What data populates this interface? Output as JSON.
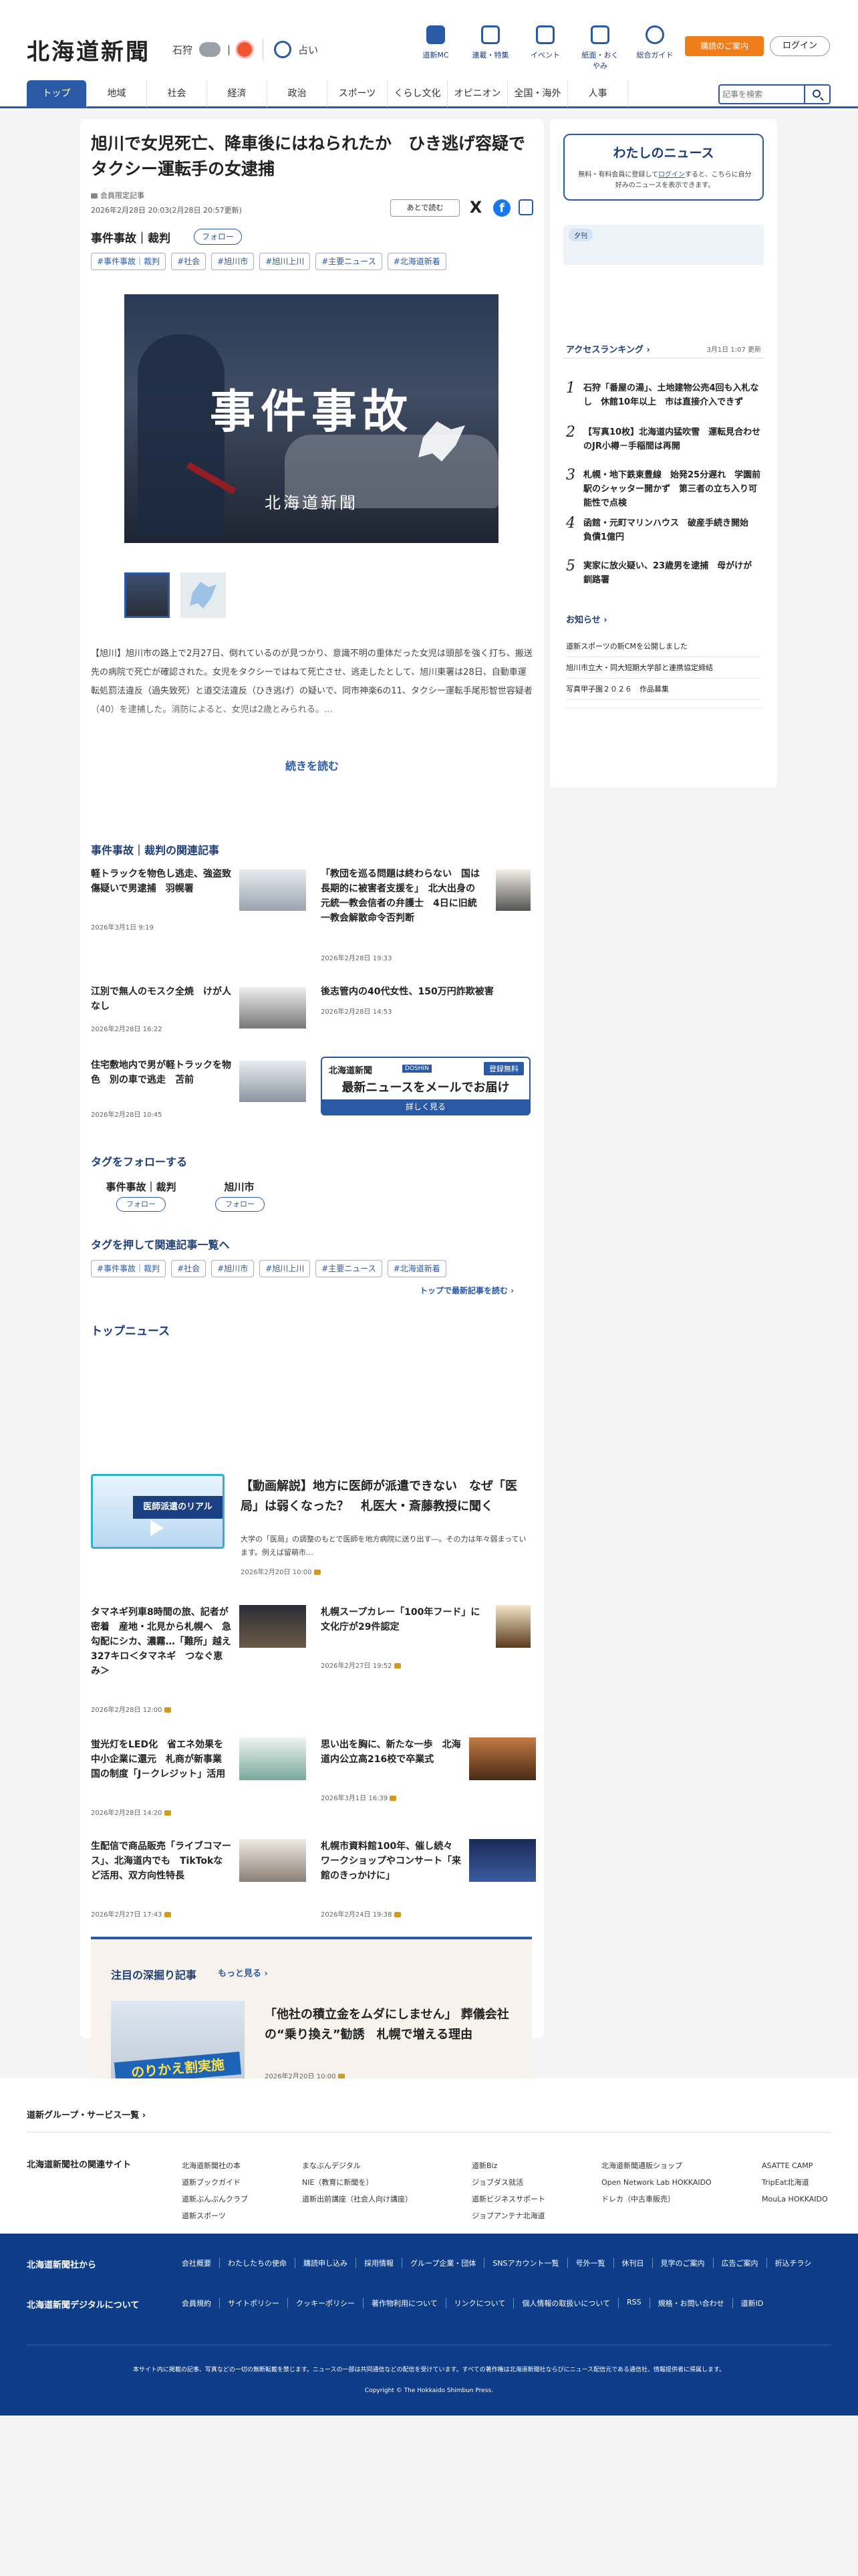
{
  "header": {
    "logo": "北海道新聞",
    "weather": {
      "city": "石狩",
      "fortune": "占い"
    },
    "nav": [
      {
        "label": "道新MC",
        "icon": "book-icon"
      },
      {
        "label": "連載・特集",
        "icon": "flag-icon"
      },
      {
        "label": "イベント",
        "icon": "calendar-icon"
      },
      {
        "label": "紙面・おくやみ",
        "icon": "newspaper-icon"
      },
      {
        "label": "総合ガイド",
        "icon": "help-icon"
      }
    ],
    "subscribe": "購読のご案内",
    "login": "ログイン"
  },
  "gnav": {
    "items": [
      "トップ",
      "地域",
      "社会",
      "経済",
      "政治",
      "スポーツ",
      "くらし文化",
      "オピニオン",
      "全国・海外",
      "人事"
    ],
    "search_placeholder": "記事を検索"
  },
  "article": {
    "title": "旭川で女児死亡、降車後にはねられたか　ひき逃げ容疑でタクシー運転手の女逮捕",
    "members_only": "会員限定記事",
    "date": "2026年2月28日 20:03(2月28日 20:57更新)",
    "read_later": "あとで読む",
    "category": "事件事故｜裁判",
    "follow": "フォロー",
    "tags": [
      "#事件事故｜裁判",
      "#社会",
      "#旭川市",
      "#旭川上川",
      "#主要ニュース",
      "#北海道新着"
    ],
    "hero_text": "事件事故",
    "hero_brand": "北海道新聞",
    "lead": "【旭川】旭川市の路上で2月27日、倒れているのが見つかり、意識不明の重体だった女児は頭部を強く打ち、搬送先の病院で死亡が確認された。女児をタクシーではねて死亡させ、逃走したとして、旭川東署は28日、自動車運転処罰法違反（過失致死）と道交法違反（ひき逃げ）の疑いで、同市神楽6の11、タクシー運転手尾形智世容疑者（40）を逮捕した。消防によると、女児は2歳とみられる。…",
    "read_more": "続きを読む"
  },
  "related": {
    "heading": "事件事故｜裁判の関連記事",
    "items": [
      {
        "title": "軽トラックを物色し逃走、強盗致傷疑いで男逮捕　羽幌署",
        "date": "2026年3月1日 9:19"
      },
      {
        "title": "「教団を巡る問題は終わらない　国は長期的に被害者支援を」　北大出身の元統一教会信者の弁護士　4日に旧統一教会解散命令否判断",
        "date": "2026年2月28日 19:33"
      },
      {
        "title": "江別で無人のモスク全焼　けが人なし",
        "date": "2026年2月28日 16:22"
      },
      {
        "title": "後志管内の40代女性、150万円詐欺被害",
        "date": "2026年2月28日 14:53"
      },
      {
        "title": "住宅敷地内で男が軽トラックを物色　別の車で逃走　苫前",
        "date": "2026年2月28日 10:45"
      }
    ],
    "ad": {
      "brand": "北海道新聞",
      "pill": "DOSHIN",
      "free": "登録無料",
      "headline": "最新ニュースをメールでお届け",
      "cta": "詳しく見る"
    }
  },
  "follow_tags": {
    "heading": "タグをフォローする",
    "items": [
      {
        "label": "事件事故｜裁判",
        "button": "フォロー"
      },
      {
        "label": "旭川市",
        "button": "フォロー"
      }
    ]
  },
  "tag_list": {
    "heading": "タグを押して関連記事一覧へ",
    "items": [
      "#事件事故｜裁判",
      "#社会",
      "#旭川市",
      "#旭川上川",
      "#主要ニュース",
      "#北海道新着"
    ],
    "latest_link": "トップで最新記事を読む"
  },
  "top_news": {
    "heading": "トップニュース",
    "feature": {
      "title": "【動画解説】地方に医師が派遣できない　なぜ「医局」は弱くなった？　札医大・斎藤教授に聞く",
      "summary": "大学の「医局」の調整のもとで医師を地方病院に送り出す―。その力は年々弱まっています。例えば留萌市…",
      "date": "2026年2月20日 10:00",
      "video_caption": "医師派遣のリアル"
    },
    "items": [
      {
        "title": "タマネギ列車8時間の旅、記者が密着　産地・北見から札幌へ　急勾配にシカ、濃霧…「難所」越え327キロ＜タマネギ　つなぐ恵み＞",
        "date": "2026年2月28日 12:00"
      },
      {
        "title": "札幌スープカレー「100年フード」に　文化庁が29件認定",
        "date": "2026年2月27日 19:52"
      },
      {
        "title": "蛍光灯をLED化　省エネ効果を中小企業に還元　札商が新事業　国の制度「J－クレジット」活用",
        "date": "2026年2月28日 14:20"
      },
      {
        "title": "思い出を胸に、新たな一歩　北海道内公立高216校で卒業式",
        "date": "2026年3月1日 16:39"
      },
      {
        "title": "生配信で商品販売「ライブコマース」、北海道内でも　TikTokなど活用、双方向性特長",
        "date": "2026年2月27日 17:43"
      },
      {
        "title": "札幌市資料館100年、催し続々　ワークショップやコンサート「来館のきっかけに」",
        "date": "2026年2月24日 19:38"
      }
    ]
  },
  "deep": {
    "heading": "注目の深掘り記事",
    "more": "もっと見る",
    "title": "「他社の積立金をムダにしません」 葬儀会社の“乗り換え”勧誘　札幌で増える理由",
    "date": "2026年2月20日 10:00",
    "image_text": "のりかえ割実施"
  },
  "sidebar": {
    "my_news": {
      "title": "わたしのニュース",
      "desc_1": "無料・有料会員に登録して",
      "login_link": "ログイン",
      "desc_2": "すると、こちらに自分好みのニュースを表示できます。"
    },
    "weekday": "夕刊",
    "ranking": {
      "title": "アクセスランキング",
      "updated": "3月1日 1:07 更新",
      "items": [
        "石狩「番屋の湯」、土地建物公売4回も入札なし　休館10年以上　市は直接介入できず",
        "【写真10枚】北海道内猛吹雪　運転見合わせのJR小樽－手稲間は再開",
        "札幌・地下鉄東豊線　始発25分遅れ　学園前駅のシャッター開かず　第三者の立ち入り可能性で点検",
        "函館・元町マリンハウス　破産手続き開始　負債1億円",
        "実家に放火疑い、23歳男を逮捕　母がけが　釧路署"
      ]
    },
    "info": {
      "title": "お知らせ",
      "items": [
        "道新スポーツの新CMを公開しました",
        "旭川市立大・同大短期大学部と連携協定締結",
        "写真甲子園２０２６　作品募集"
      ]
    }
  },
  "footer": {
    "group_heading": "道新グループ・サービス一覧",
    "related_sites_label": "北海道新聞社の関連サイト",
    "cols": [
      [
        "北海道新聞社の本",
        "道新ブックガイド",
        "道新ぶんぶんクラブ",
        "道新スポーツ"
      ],
      [
        "まなぶんデジタル",
        "NIE（教育に新聞を）",
        "道新出前講座（社会人向け講座）"
      ],
      [
        "道新Biz",
        "ジョブダス就活",
        "道新ビジネスサポート",
        "ジョブアンテナ北海道"
      ],
      [
        "北海道新聞通販ショップ",
        "Open Network Lab HOKKAIDO",
        "ドレカ（中古車販売）"
      ],
      [
        "ASATTE CAMP",
        "TripEat北海道",
        "MouLa HOKKAIDO"
      ]
    ],
    "company_heading": "北海道新聞社から",
    "company_links": [
      "会社概要",
      "わたしたちの使命",
      "購読申し込み",
      "採用情報",
      "グループ企業・団体",
      "SNSアカウント一覧",
      "号外一覧",
      "休刊日",
      "見学のご案内",
      "広告ご案内",
      "折込チラシ"
    ],
    "digital_heading": "北海道新聞デジタルについて",
    "digital_links": [
      "会員規約",
      "サイトポリシー",
      "クッキーポリシー",
      "著作物利用について",
      "リンクについて",
      "個人情報の取扱いについて",
      "RSS",
      "規格・お問い合わせ",
      "道新ID"
    ],
    "notice": "本サイト内に掲載の記事、写真などの一切の無断転載を禁じます。ニュースの一部は共同通信などの配信を受けています。すべての著作権は北海道新聞社ならびにニュース配信元である通信社、情報提供者に帰属します。",
    "copyright": "Copyright © The Hokkaido Shimbun Press."
  }
}
